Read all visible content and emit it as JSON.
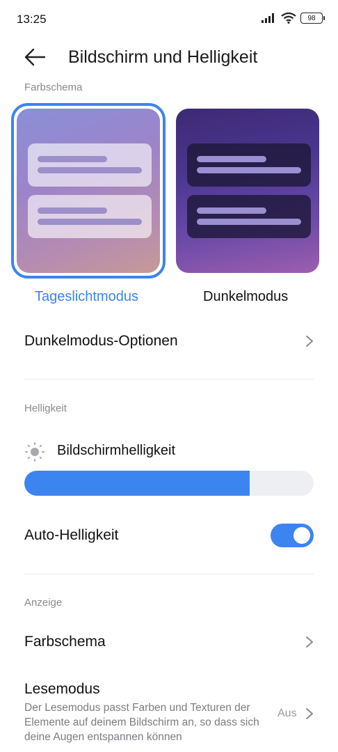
{
  "status_bar": {
    "time": "13:25",
    "battery": "98"
  },
  "header": {
    "title": "Bildschirm und Helligkeit"
  },
  "color_scheme_section": {
    "label": "Farbschema",
    "options": [
      {
        "label": "Tageslichtmodus",
        "selected": true
      },
      {
        "label": "Dunkelmodus",
        "selected": false
      }
    ]
  },
  "dark_mode_options": {
    "label": "Dunkelmodus-Optionen"
  },
  "brightness_section": {
    "label": "Helligkeit",
    "screen_brightness_label": "Bildschirmhelligkeit",
    "brightness_level": 0.78,
    "auto_brightness_label": "Auto-Helligkeit",
    "auto_brightness_on": true
  },
  "display_section": {
    "label": "Anzeige",
    "color_scheme_row": "Farbschema",
    "reading_mode": {
      "title": "Lesemodus",
      "description": "Der Lesemodus passt Farben und Texturen der Elemente auf deinem Bildschirm an, so dass sich deine Augen entspannen können",
      "value": "Aus"
    }
  },
  "colors": {
    "accent": "#3c84f0"
  }
}
